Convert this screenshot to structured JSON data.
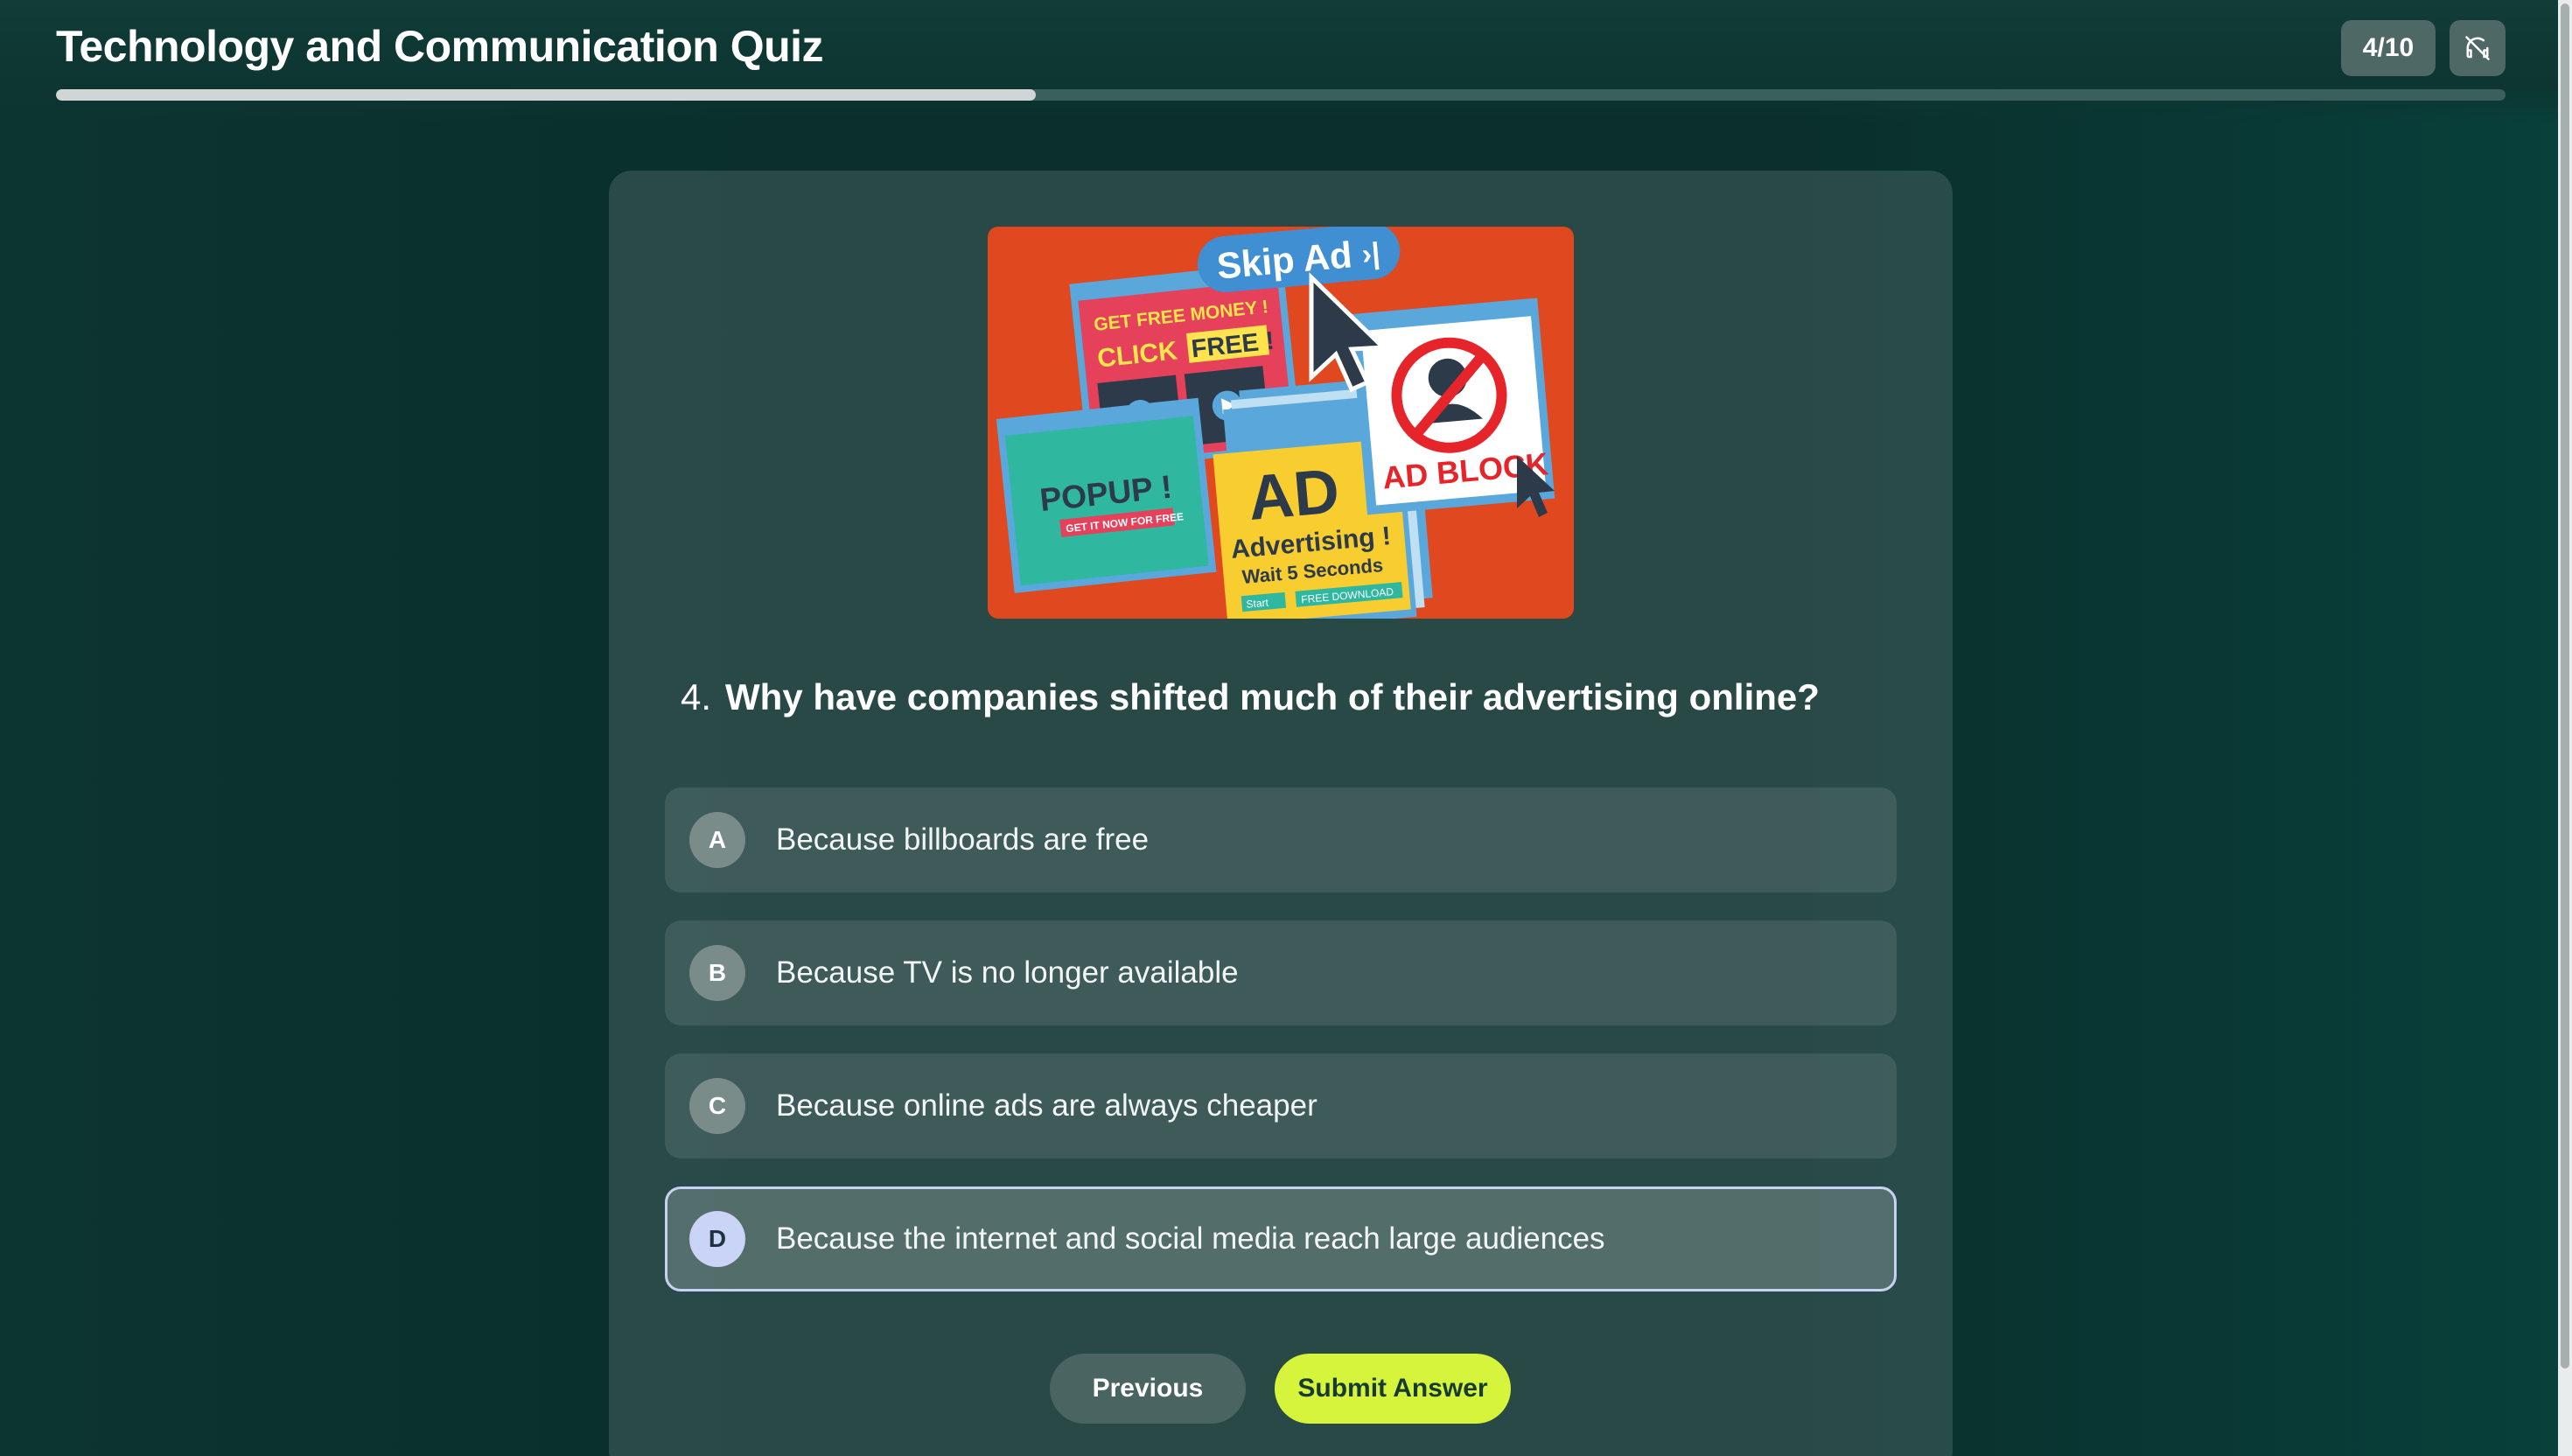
{
  "header": {
    "title": "Technology and Communication Quiz",
    "counter": "4/10",
    "progress_fraction": 0.4,
    "audio_icon": "audio-off-icon"
  },
  "image": {
    "texts": {
      "skip": "Skip Ad",
      "money": "GET FREE MONEY !",
      "click": "CLICK",
      "free": "FREE !",
      "popup": "POPUP !",
      "popup_sub": "GET IT NOW FOR FREE",
      "ad": "AD",
      "advertising": "Advertising !",
      "wait": "Wait 5 Seconds",
      "start": "Start",
      "download": "FREE DOWNLOAD",
      "adblock": "AD BLOCK"
    }
  },
  "question": {
    "number": "4.",
    "text": "Why have companies shifted much of their advertising online?"
  },
  "options": [
    {
      "letter": "A",
      "text": "Because billboards are free"
    },
    {
      "letter": "B",
      "text": "Because TV is no longer available"
    },
    {
      "letter": "C",
      "text": "Because online ads are always cheaper"
    },
    {
      "letter": "D",
      "text": "Because the internet and social media reach large audiences",
      "selected": true
    }
  ],
  "buttons": {
    "previous": "Previous",
    "submit": "Submit Answer"
  },
  "colors": {
    "accent": "#d6f43c",
    "selected_border": "#c7d1f2"
  }
}
